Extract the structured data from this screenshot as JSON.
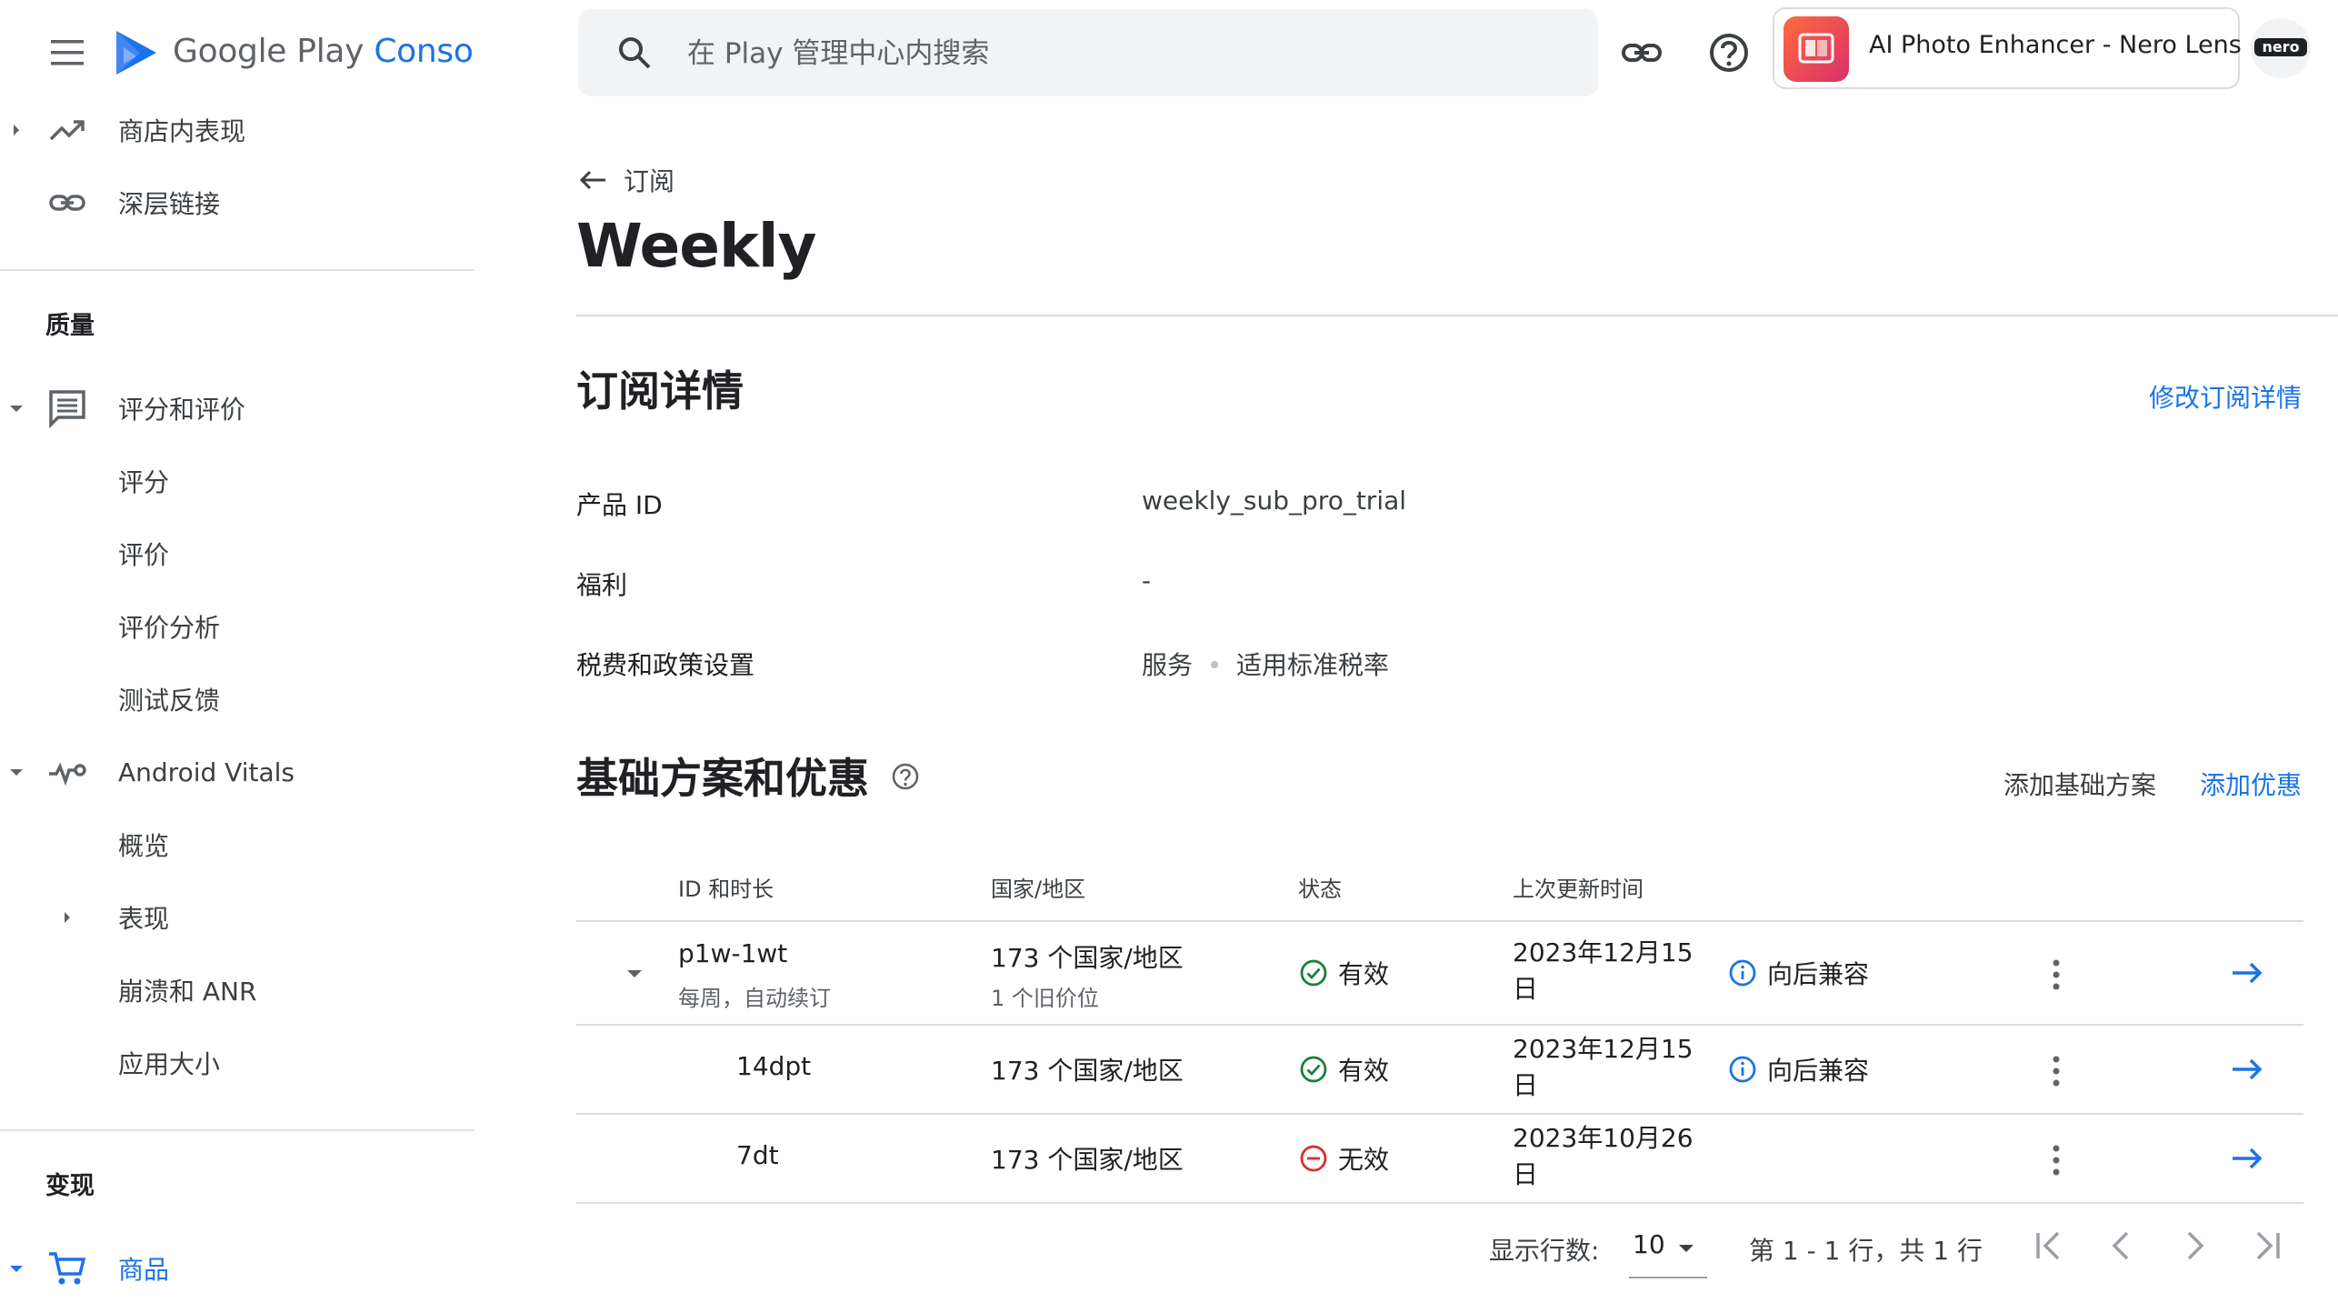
{
  "brand": {
    "google": "Google Play",
    "console": "Console"
  },
  "sidebar": {
    "items_top": [
      {
        "label": "商店内表现",
        "icon": "trending-up-icon"
      },
      {
        "label": "深层链接",
        "icon": "link-icon"
      }
    ],
    "quality_heading": "质量",
    "ratings": {
      "label": "评分和评价",
      "children": [
        "评分",
        "评价",
        "评价分析",
        "测试反馈"
      ]
    },
    "vitals": {
      "label": "Android Vitals",
      "children": [
        "概览",
        "表现",
        "崩溃和 ANR",
        "应用大小"
      ]
    },
    "monetize_heading": "变现",
    "products_label": "商品"
  },
  "search": {
    "placeholder": "在 Play 管理中心内搜索"
  },
  "app": {
    "name": "AI Photo Enhancer - Nero Lens",
    "avatar_text": "nero"
  },
  "main": {
    "back_label": "订阅",
    "title": "Weekly",
    "details": {
      "heading": "订阅详情",
      "edit_link": "修改订阅详情",
      "rows": [
        {
          "label": "产品 ID",
          "value": "weekly_sub_pro_trial"
        },
        {
          "label": "福利",
          "value": "-"
        },
        {
          "label": "税费和政策设置",
          "value_a": "服务",
          "value_b": "适用标准税率"
        }
      ]
    },
    "plans": {
      "heading": "基础方案和优惠",
      "add_base": "添加基础方案",
      "add_offer": "添加优惠",
      "columns": [
        "ID 和时长",
        "国家/地区",
        "状态",
        "上次更新时间"
      ],
      "rows": [
        {
          "id": "p1w-1wt",
          "sub": "每周，自动续订",
          "region": "173 个国家/地区",
          "region_sub": "1 个旧价位",
          "status": "有效",
          "date": "2023年12月15日",
          "compat": "向后兼容"
        },
        {
          "id": "14dpt",
          "region": "173 个国家/地区",
          "status": "有效",
          "date": "2023年12月15日",
          "compat": "向后兼容"
        },
        {
          "id": "7dt",
          "region": "173 个国家/地区",
          "status": "无效",
          "date": "2023年10月26日"
        }
      ]
    },
    "pagination": {
      "rows_label": "显示行数:",
      "rows_value": "10",
      "range": "第 1 - 1 行，共 1 行"
    }
  },
  "colors": {
    "accent": "#1a73e8",
    "active": "#188038",
    "inactive": "#d93025"
  }
}
